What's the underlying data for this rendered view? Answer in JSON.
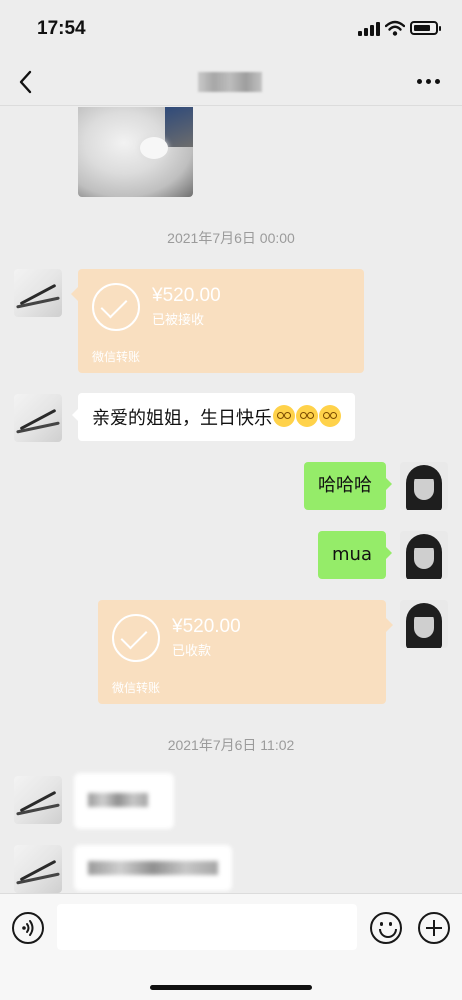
{
  "status_bar": {
    "time": "17:54"
  },
  "nav": {
    "title": "",
    "icons": [
      "back-icon",
      "more-icon"
    ]
  },
  "messages": {
    "timestamp_1": "2021年7月6日 00:00",
    "transfer_in": {
      "amount": "¥520.00",
      "status": "已被接收",
      "footer": "微信转账"
    },
    "greeting": {
      "text": "亲爱的姐姐，生日快乐",
      "emoji_count": 3
    },
    "reply_1": "哈哈哈",
    "reply_2": "mua",
    "transfer_out": {
      "amount": "¥520.00",
      "status": "已收款",
      "footer": "微信转账"
    },
    "timestamp_2": "2021年7月6日 11:02"
  },
  "input_bar": {
    "placeholder": "",
    "icons": [
      "voice-icon",
      "emoji-icon",
      "plus-icon"
    ]
  },
  "colors": {
    "background": "#ededed",
    "transfer": "#f9dfc0",
    "green_bubble": "#95ec69",
    "white_bubble": "#ffffff"
  }
}
